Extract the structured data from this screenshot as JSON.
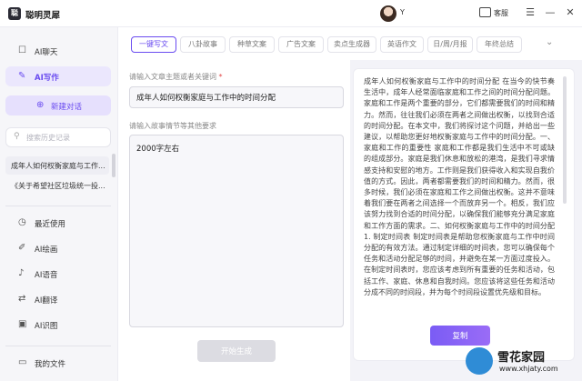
{
  "app": {
    "logo_text": "聪",
    "name": "聪明灵犀"
  },
  "user": {
    "name": "Y"
  },
  "header": {
    "service_label": "客服"
  },
  "sidebar": {
    "nav_top": [
      {
        "icon": "chat-bubble-icon",
        "label": "AI聊天"
      },
      {
        "icon": "pen-icon",
        "label": "AI写作"
      }
    ],
    "new_chat_label": "新建对话",
    "search_placeholder": "搜索历史记录",
    "history": [
      "成年人如何权衡家庭与工作...",
      "《关于希望社区垃圾统一投..."
    ],
    "nav_bottom": [
      {
        "icon": "clock-icon",
        "label": "最近使用"
      },
      {
        "icon": "paint-icon",
        "label": "AI绘画"
      },
      {
        "icon": "mic-icon",
        "label": "AI语音"
      },
      {
        "icon": "translate-icon",
        "label": "AI翻译"
      },
      {
        "icon": "image-icon",
        "label": "AI识图"
      }
    ],
    "my_files_label": "我的文件"
  },
  "tabs": [
    "一键写文",
    "八卦故事",
    "种草文案",
    "广告文案",
    "卖点生成器",
    "英语作文",
    "日/周/月报",
    "年终总结"
  ],
  "form": {
    "topic_label": "请输入文章主题或者关键词",
    "topic_required_mark": "*",
    "topic_value": "成年人如何权衡家庭与工作中的时间分配",
    "requirements_label": "请输入故事情节等其他要求",
    "requirements_value": "2000字左右",
    "generate_label": "开始生成"
  },
  "result": {
    "text": "成年人如何权衡家庭与工作中的时间分配 在当今的快节奏生活中，成年人经常面临家庭和工作之间的时间分配问题。家庭和工作是两个重要的部分，它们都需要我们的时间和精力。然而，往往我们必须在两者之间做出权衡，以找到合适的时间分配。在本文中，我们将探讨这个问题，并给出一些建议，以帮助您更好地权衡家庭与工作中的时间分配。一、家庭和工作的重要性 家庭和工作都是我们生活中不可或缺的组成部分。家庭是我们休息和放松的港湾，是我们寻求情感支持和安慰的地方。工作则是我们获得收入和实现自我价值的方式。因此，两者都需要我们的时间和精力。然而，很多时候，我们必须在家庭和工作之间做出权衡。这并不意味着我们要在两者之间选择一个而放弃另一个。相反，我们应该努力找到合适的时间分配，以确保我们能够充分满足家庭和工作方面的需求。二、如何权衡家庭与工作中的时间分配 1. 制定时间表 制定时间表是帮助您权衡家庭与工作中时间分配的有效方法。通过制定详细的时间表，您可以确保每个任务和活动分配足够的时间，并避免在某一方面过度投入。在制定时间表时，您应该考虑到所有重要的任务和活动，包括工作、家庭、休息和自我时间。您应该将这些任务和活动分成不同的时间段，并为每个时间段设置优先级和目标。",
    "copy_label": "复制"
  },
  "watermark": {
    "title": "雪花家园",
    "subtitle": "www.xhjaty.com"
  },
  "colors": {
    "accent": "#6a4cf0",
    "accent_light": "#ebe7fd",
    "button_disabled": "#dcdce2"
  }
}
